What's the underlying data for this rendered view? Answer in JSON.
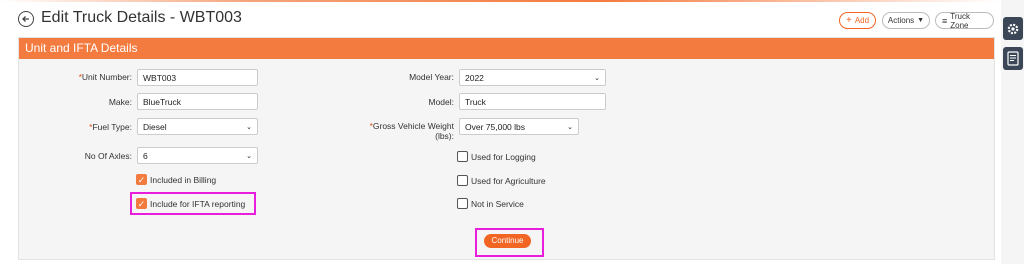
{
  "header": {
    "title": "Edit Truck Details - WBT003",
    "add_label": "Add",
    "actions_label": "Actions",
    "truck_zone_label": "Truck Zone"
  },
  "panel": {
    "title": "Unit and IFTA Details"
  },
  "form": {
    "unit_number": {
      "label": "Unit Number:",
      "value": "WBT003",
      "required": true
    },
    "make": {
      "label": "Make:",
      "value": "BlueTruck"
    },
    "fuel_type": {
      "label": "Fuel Type:",
      "value": "Diesel",
      "required": true
    },
    "no_of_axles": {
      "label": "No Of Axles:",
      "value": "6"
    },
    "model_year": {
      "label": "Model Year:",
      "value": "2022"
    },
    "model": {
      "label": "Model:",
      "value": "Truck"
    },
    "gvw": {
      "label_line1": "Gross Vehicle Weight",
      "label_line2": "(lbs):",
      "value": "Over 75,000 lbs",
      "required": true
    },
    "included_in_billing": {
      "label": "Included in Billing",
      "checked": true
    },
    "include_ifta": {
      "label": "Include for IFTA reporting",
      "checked": true
    },
    "used_for_logging": {
      "label": "Used for Logging",
      "checked": false
    },
    "used_for_agriculture": {
      "label": "Used for Agriculture",
      "checked": false
    },
    "not_in_service": {
      "label": "Not in Service",
      "checked": false
    }
  },
  "continue_label": "Continue",
  "colors": {
    "accent": "#f47b3f",
    "highlight": "#e91edc",
    "rail_button": "#3b4756"
  },
  "icons": [
    "back-arrow-icon",
    "plus-icon",
    "caret-down-icon",
    "menu-lines-icon",
    "gear-icon",
    "document-icon",
    "chevron-down-icon",
    "checkmark-icon"
  ]
}
